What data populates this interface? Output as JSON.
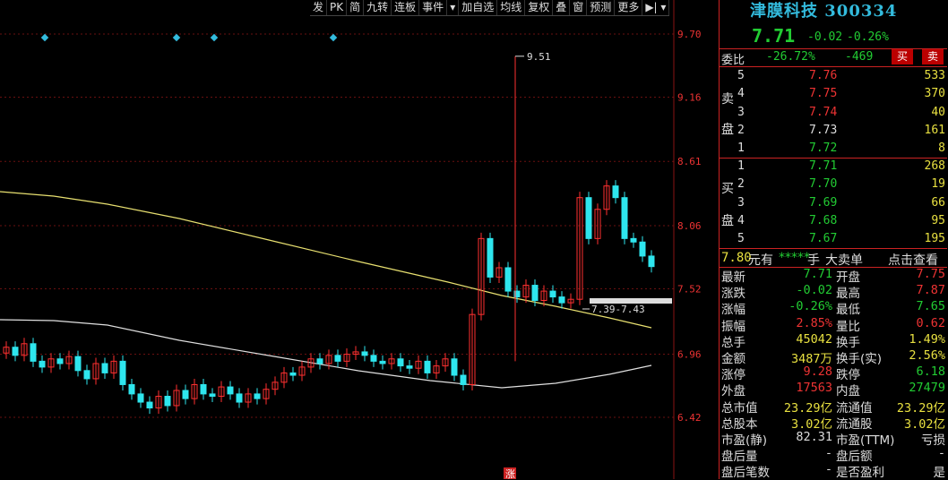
{
  "toolbar": {
    "items": [
      "发",
      "PK",
      "简",
      "九转",
      "连板",
      "事件"
    ],
    "items2": [
      "加自选",
      "均线",
      "复权",
      "叠",
      "窗",
      "预测",
      "更多"
    ],
    "icons": [
      "eye-icon",
      "hand-icon",
      "undo-icon",
      "cut-icon",
      "zoom-in-icon",
      "zoom-out-icon"
    ]
  },
  "chart": {
    "y_ticks": [
      "9.70",
      "9.16",
      "8.61",
      "8.06",
      "7.52",
      "6.96",
      "6.42"
    ],
    "high_label": "9.51",
    "range_label": "7.39-7.43",
    "limit_up_marker": "涨"
  },
  "chart_data": {
    "type": "candlestick",
    "ylim": [
      6.15,
      9.75
    ],
    "y_ticks": [
      9.7,
      9.16,
      8.61,
      8.06,
      7.52,
      6.96,
      6.42
    ],
    "colors": {
      "up": "#ff3030",
      "down": "#2ee6ee",
      "ma1": "#e8e070",
      "ma2": "#e0e0e0"
    }
  },
  "quote": {
    "name": "津膜科技",
    "code": "300334",
    "price": "7.71",
    "change": "-0.02",
    "pct": "-0.26%",
    "weibi_label": "委比",
    "weibi_pct": "-26.72%",
    "weibi_diff": "-469",
    "buy_btn": "买",
    "sell_btn": "卖",
    "sell_label": [
      "卖",
      "盘"
    ],
    "buy_label": [
      "买",
      "盘"
    ],
    "asks": [
      {
        "lvl": "5",
        "price": "7.76",
        "vol": "533"
      },
      {
        "lvl": "4",
        "price": "7.75",
        "vol": "370"
      },
      {
        "lvl": "3",
        "price": "7.74",
        "vol": "40"
      },
      {
        "lvl": "2",
        "price": "7.73",
        "vol": "161"
      },
      {
        "lvl": "1",
        "price": "7.72",
        "vol": "8"
      }
    ],
    "bids": [
      {
        "lvl": "1",
        "price": "7.71",
        "vol": "268"
      },
      {
        "lvl": "2",
        "price": "7.70",
        "vol": "19"
      },
      {
        "lvl": "3",
        "price": "7.69",
        "vol": "66"
      },
      {
        "lvl": "4",
        "price": "7.68",
        "vol": "95"
      },
      {
        "lvl": "5",
        "price": "7.67",
        "vol": "195"
      }
    ],
    "big_order": {
      "price": "7.80",
      "unit": "元有",
      "stars": "*****",
      "hand": "手",
      "label": "大卖单",
      "link": "点击查看"
    },
    "stats": [
      {
        "k1": "最新",
        "v1": "7.71",
        "c1": "#2c3",
        "k2": "开盘",
        "v2": "7.75",
        "c2": "#e33"
      },
      {
        "k1": "涨跌",
        "v1": "-0.02",
        "c1": "#2c3",
        "k2": "最高",
        "v2": "7.87",
        "c2": "#e33"
      },
      {
        "k1": "涨幅",
        "v1": "-0.26%",
        "c1": "#2c3",
        "k2": "最低",
        "v2": "7.65",
        "c2": "#2c3"
      },
      {
        "k1": "振幅",
        "v1": "2.85%",
        "c1": "#e33",
        "k2": "量比",
        "v2": "0.62",
        "c2": "#e33"
      },
      {
        "k1": "总手",
        "v1": "45042",
        "c1": "#e8e040",
        "k2": "换手",
        "v2": "1.49%",
        "c2": "#e8e040"
      },
      {
        "k1": "金额",
        "v1": "3487万",
        "c1": "#e8e040",
        "k2": "换手(实)",
        "v2": "2.56%",
        "c2": "#e8e040"
      },
      {
        "k1": "涨停",
        "v1": "9.28",
        "c1": "#e33",
        "k2": "跌停",
        "v2": "6.18",
        "c2": "#2c3"
      },
      {
        "k1": "外盘",
        "v1": "17563",
        "c1": "#e33",
        "k2": "内盘",
        "v2": "27479",
        "c2": "#2c3"
      },
      {
        "k1": "总市值",
        "v1": "23.29亿",
        "c1": "#e8e040",
        "k2": "流通值",
        "v2": "23.29亿",
        "c2": "#e8e040"
      },
      {
        "k1": "总股本",
        "v1": "3.02亿",
        "c1": "#e8e040",
        "k2": "流通股",
        "v2": "3.02亿",
        "c2": "#e8e040"
      },
      {
        "k1": "市盈(静)",
        "v1": "82.31",
        "c1": "#ddd",
        "k2": "市盈(TTM)",
        "v2": "亏损",
        "c2": "#ddd"
      },
      {
        "k1": "盘后量",
        "v1": "-",
        "c1": "#ddd",
        "k2": "盘后额",
        "v2": "-",
        "c2": "#ddd"
      },
      {
        "k1": "盘后笔数",
        "v1": "-",
        "c1": "#ddd",
        "k2": "是否盈利",
        "v2": "是",
        "c2": "#ddd"
      }
    ]
  }
}
